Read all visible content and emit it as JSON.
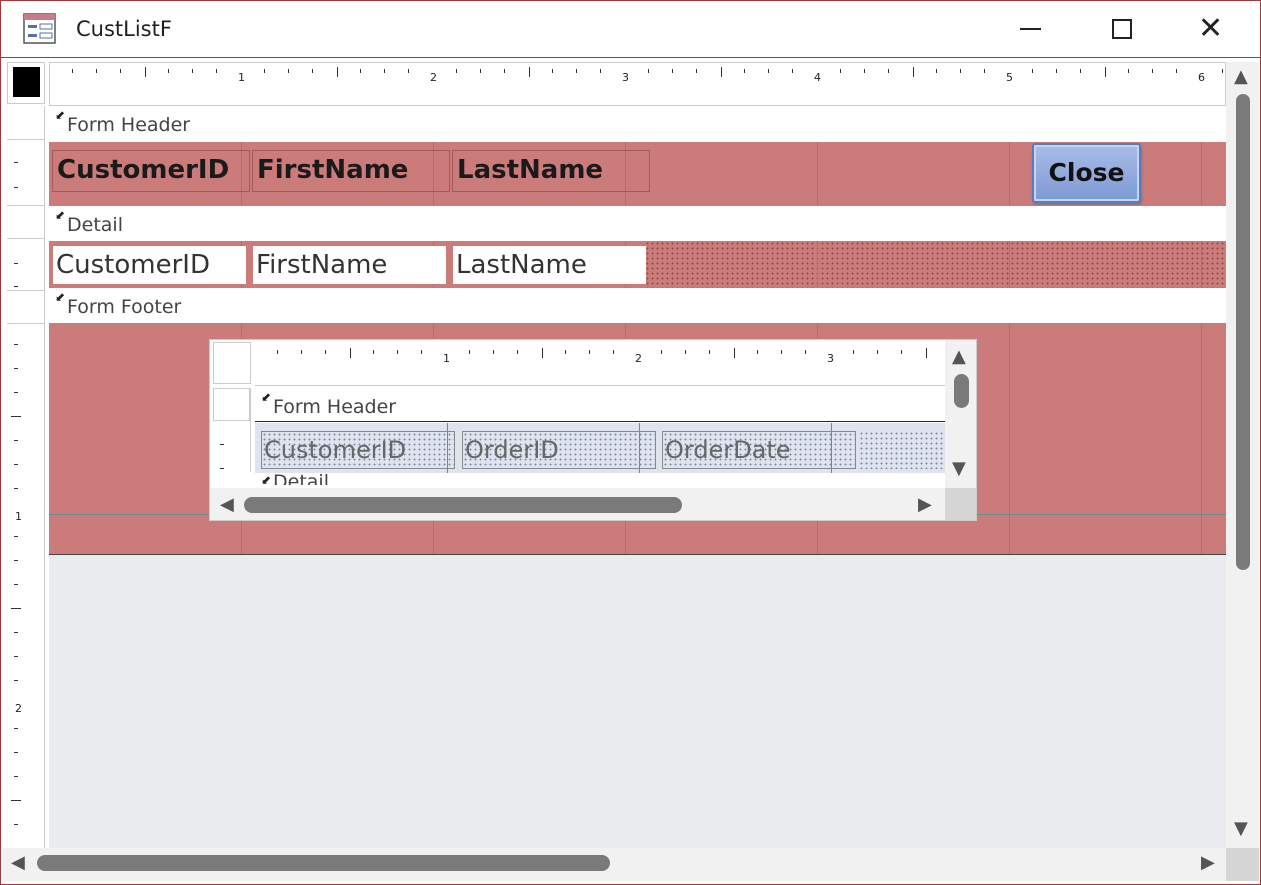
{
  "window": {
    "title": "CustListF",
    "icon": "form-icon",
    "controls": {
      "minimize_icon": "minimize-icon",
      "maximize_icon": "maximize-icon",
      "close_icon": "close-icon"
    }
  },
  "ruler": {
    "horizontal_numbers": [
      "1",
      "2",
      "3",
      "4",
      "5",
      "6"
    ],
    "vertical_numbers": [
      "1",
      "2"
    ]
  },
  "sections": {
    "form_header": "Form Header",
    "detail": "Detail",
    "form_footer": "Form Footer"
  },
  "header_labels": [
    "CustomerID",
    "FirstName",
    "LastName"
  ],
  "detail_textboxes": [
    "CustomerID",
    "FirstName",
    "LastName"
  ],
  "close_button": {
    "label": "Close"
  },
  "subform": {
    "ruler_numbers": [
      "1",
      "2",
      "3"
    ],
    "form_header": "Form Header",
    "detail_partial": "Detail",
    "header_labels": [
      "CustomerID",
      "OrderID",
      "OrderDate"
    ]
  },
  "colors": {
    "section_fill": "#cc7b7b",
    "frame_accent": "#a4373a",
    "button_fill": "#8ea7dc",
    "subform_header_fill": "#dfe3ed"
  }
}
